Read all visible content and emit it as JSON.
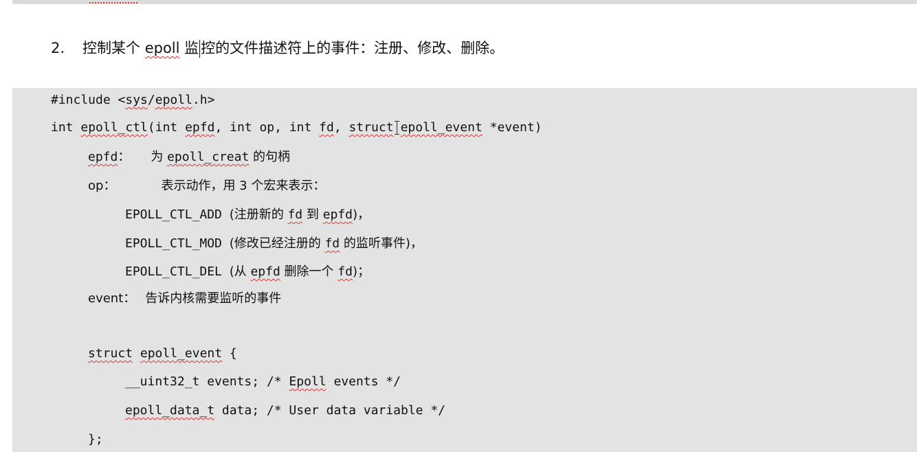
{
  "heading": {
    "number": "2.",
    "text_before": "控制某个 ",
    "text_epoll": "epoll",
    "text_mid": " 监",
    "text_after": "控的文件描述符上的事件：注册、修改、删除。"
  },
  "code": {
    "include": {
      "prefix": "#include <",
      "sys": "sys",
      "slash": "/",
      "file": "epoll",
      "suffix": ".h>"
    },
    "signature": {
      "t1": "int ",
      "fn": "epoll_ctl",
      "t2": "(int ",
      "epfd": "epfd",
      "t3": ", int op, int ",
      "fd": "fd",
      "t4": ", ",
      "struct": "struct",
      "type": "epoll_event",
      "t5": " *event)"
    },
    "epfd_desc": {
      "name": "epfd",
      "colon": "：",
      "text1": "为 ",
      "ref": "epoll_creat",
      "text2": " 的句柄"
    },
    "op_desc": {
      "name": "op：",
      "text": "表示动作，用 3 个宏来表示："
    },
    "op_add": {
      "macro": "EPOLL_CTL_ADD ",
      "t1": "(注册新的 ",
      "fd": "fd",
      "t2": " 到 ",
      "epfd": "epfd",
      "t3": ")，"
    },
    "op_mod": {
      "macro": "EPOLL_CTL_MOD ",
      "t1": "(修改已经注册的 ",
      "fd": "fd",
      "t2": " 的监听事件)，"
    },
    "op_del": {
      "macro": "EPOLL_CTL_DEL ",
      "t1": "(从 ",
      "epfd": "epfd",
      "t2": " 删除一个 ",
      "fd": "fd",
      "t3": ")；"
    },
    "event_desc": {
      "name": "event：",
      "text": "告诉内核需要监听的事件"
    },
    "struct_open": {
      "kw": "struct",
      "sp": " ",
      "name": "epoll_event",
      "brace": " {"
    },
    "field1": {
      "t1": "__uint32_t events; /* ",
      "epoll": "Epoll",
      "t2": " events */"
    },
    "field2": {
      "type": "epoll_data_t",
      "t1": " data; /* User data variable */"
    },
    "struct_close": "};"
  }
}
